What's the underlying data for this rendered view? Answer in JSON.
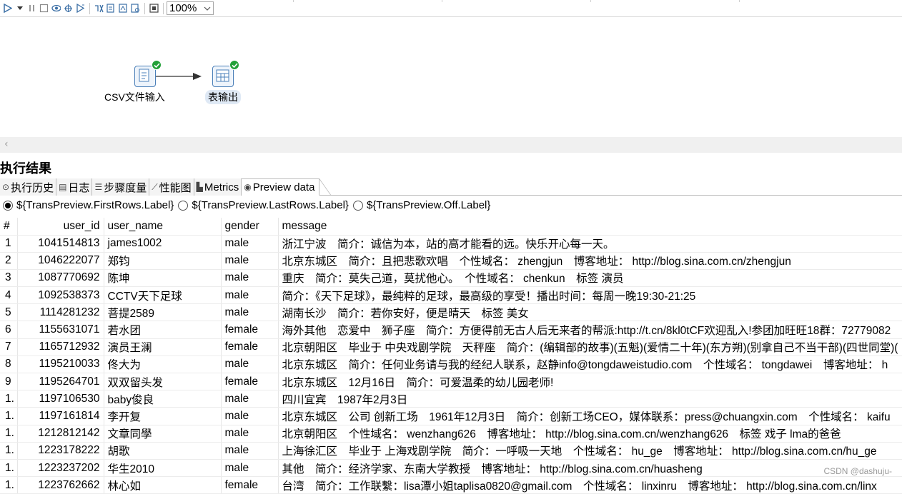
{
  "toolbar": {
    "zoom_value": "100%",
    "icons": [
      "play-icon",
      "play-options-icon",
      "pause-icon",
      "stop-icon",
      "preview-icon",
      "debug-icon",
      "replay-icon",
      "verify-icon",
      "analyze-icon",
      "sql-icon",
      "explore-db-icon",
      "show-results-icon"
    ]
  },
  "canvas": {
    "nodes": [
      {
        "label": "CSV文件输入",
        "icon": "csv-input-icon"
      },
      {
        "label": "表输出",
        "icon": "table-output-icon"
      }
    ]
  },
  "results": {
    "title": "执行结果",
    "tabs": [
      {
        "label": "执行历史",
        "icon": "history-icon"
      },
      {
        "label": "日志",
        "icon": "log-icon"
      },
      {
        "label": "步骤度量",
        "icon": "step-metrics-icon"
      },
      {
        "label": "性能图",
        "icon": "performance-icon"
      },
      {
        "label": "Metrics",
        "icon": "metrics-icon"
      },
      {
        "label": "Preview data",
        "icon": "eye-icon"
      }
    ],
    "radios": [
      {
        "label": "${TransPreview.FirstRows.Label}",
        "selected": true
      },
      {
        "label": "${TransPreview.LastRows.Label}",
        "selected": false
      },
      {
        "label": "${TransPreview.Off.Label}",
        "selected": false
      }
    ]
  },
  "table": {
    "columns": [
      "#",
      "user_id",
      "user_name",
      "gender",
      "message"
    ],
    "rows": [
      [
        "1",
        "1041514813",
        "james1002",
        "male",
        "浙江宁波　简介：诚信为本，站的高才能看的远。快乐开心每一天。"
      ],
      [
        "2",
        "1046222077",
        "郑钧",
        "male",
        "北京东城区　简介：且把悲歌欢唱　个性域名：  zhengjun　博客地址：  http://blog.sina.com.cn/zhengjun"
      ],
      [
        "3",
        "1087770692",
        "陈坤",
        "male",
        "重庆　简介：莫失己道，莫扰他心。　个性域名：  chenkun　标签  演员"
      ],
      [
        "4",
        "1092538373",
        "CCTV天下足球",
        "male",
        "简介：《天下足球》，最纯粹的足球，最高级的享受！播出时间：每周一晚19:30-21:25"
      ],
      [
        "5",
        "1114281232",
        "菩提2589",
        "male",
        "湖南长沙　简介：若你安好，便是晴天　标签  美女"
      ],
      [
        "6",
        "1155631071",
        "若水团",
        "female",
        "海外其他　恋爱中　狮子座　简介：方便得前无古人后无来者的帮派:http://t.cn/8kl0tCF欢迎乱入!参团加旺旺18群：72779082"
      ],
      [
        "7",
        "1165712932",
        "演员王澜",
        "female",
        "北京朝阳区　毕业于  中央戏剧学院　天秤座　简介：(编辑部的故事)(五魁)(爱情二十年)(东方朔)(别拿自己不当干部)(四世同堂)("
      ],
      [
        "8",
        "1195210033",
        "佟大为",
        "male",
        "北京东城区　简介：任何业务请与我的经纪人联系，赵静info@tongdaweistudio.com　个性域名：  tongdawei　博客地址：  h"
      ],
      [
        "9",
        "1195264701",
        "双双留头发",
        "female",
        "北京东城区　12月16日　简介：可爱温柔的幼儿园老师!"
      ],
      [
        "1.",
        "1197106530",
        "baby俊良",
        "male",
        "四川宜宾　1987年2月3日"
      ],
      [
        "1.",
        "1197161814",
        "李开复",
        "male",
        "北京东城区　公司  创新工场　1961年12月3日　简介：创新工场CEO，媒体联系：press@chuangxin.com　个性域名：  kaifu"
      ],
      [
        "1.",
        "1212812142",
        "文章同學",
        "male",
        "北京朝阳区　个性域名：  wenzhang626　博客地址：  http://blog.sina.com.cn/wenzhang626　标签  戏子  lma的爸爸"
      ],
      [
        "1.",
        "1223178222",
        "胡歌",
        "male",
        "上海徐汇区　毕业于  上海戏剧学院　简介：一呼吸一天地　个性域名：  hu_ge　博客地址：  http://blog.sina.com.cn/hu_ge"
      ],
      [
        "1.",
        "1223237202",
        "华生2010",
        "male",
        "其他　简介：经济学家、东南大学教授　博客地址：  http://blog.sina.com.cn/huasheng"
      ],
      [
        "1.",
        "1223762662",
        "林心如",
        "female",
        "台湾　简介：工作联繫：lisa潭小姐taplisa0820@gmail.com　个性域名：  linxinru　博客地址：  http://blog.sina.com.cn/linx"
      ]
    ]
  },
  "watermark": "CSDN @dashuju-"
}
